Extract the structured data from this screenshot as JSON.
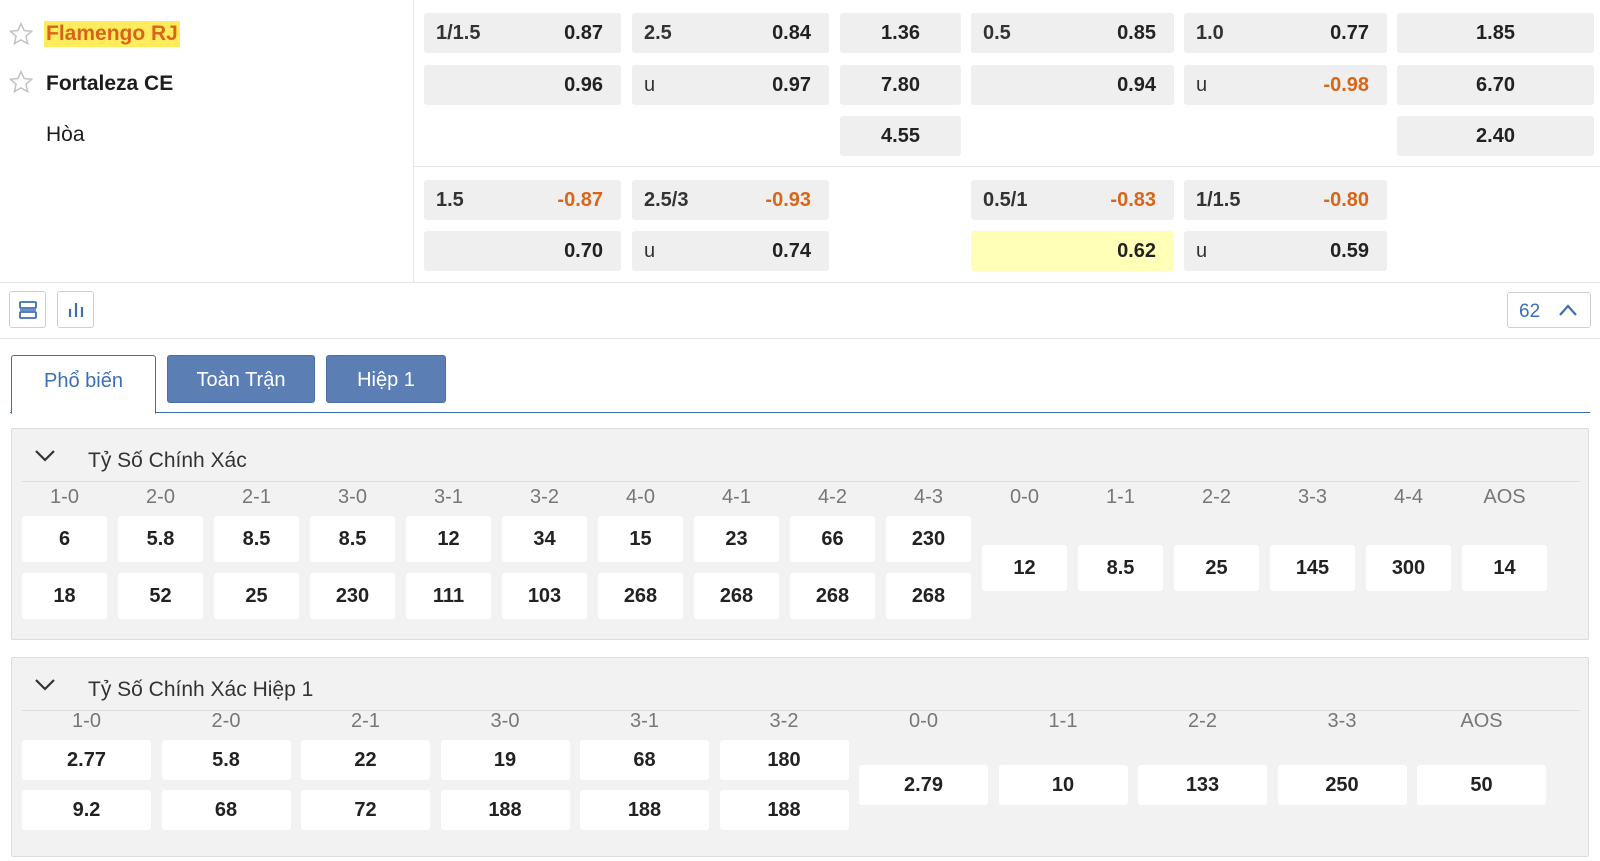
{
  "match": {
    "home": "Flamengo RJ",
    "away": "Fortaleza CE",
    "draw": "Hòa"
  },
  "odds": {
    "r1": {
      "hdp_line": "1/1.5",
      "hdp_home": "0.87",
      "ou_line": "2.5",
      "ou_over": "0.84",
      "x12_home": "1.36",
      "h1_hdp_line": "0.5",
      "h1_hdp_home": "0.85",
      "h1_ou_line": "1.0",
      "h1_ou_over": "0.77",
      "h1_x12_home": "1.85"
    },
    "r2": {
      "hdp_away": "0.96",
      "ou_u": "u",
      "ou_under": "0.97",
      "x12_away": "7.80",
      "h1_hdp_away": "0.94",
      "h1_ou_u": "u",
      "h1_ou_under": "-0.98",
      "h1_x12_away": "6.70"
    },
    "r3": {
      "x12_draw": "4.55",
      "h1_x12_draw": "2.40"
    },
    "r4": {
      "hdp_line": "1.5",
      "hdp_home": "-0.87",
      "ou_line": "2.5/3",
      "ou_over": "-0.93",
      "h1_hdp_line": "0.5/1",
      "h1_hdp_home": "-0.83",
      "h1_ou_line": "1/1.5",
      "h1_ou_over": "-0.80"
    },
    "r5": {
      "hdp_away": "0.70",
      "ou_u": "u",
      "ou_under": "0.74",
      "h1_hdp_away": "0.62",
      "h1_ou_u": "u",
      "h1_ou_under": "0.59"
    }
  },
  "toolbar": {
    "count": "62"
  },
  "tabs": [
    "Phổ biến",
    "Toàn Trận",
    "Hiệp 1"
  ],
  "correct_score": {
    "title": "Tỷ Số Chính Xác",
    "headers": [
      "1-0",
      "2-0",
      "2-1",
      "3-0",
      "3-1",
      "3-2",
      "4-0",
      "4-1",
      "4-2",
      "4-3",
      "0-0",
      "1-1",
      "2-2",
      "3-3",
      "4-4",
      "AOS"
    ],
    "home_row": [
      "6",
      "5.8",
      "8.5",
      "8.5",
      "12",
      "34",
      "15",
      "23",
      "66",
      "230"
    ],
    "away_row": [
      "18",
      "52",
      "25",
      "230",
      "111",
      "103",
      "268",
      "268",
      "268",
      "268"
    ],
    "draw_row": [
      "12",
      "8.5",
      "25",
      "145",
      "300",
      "14"
    ]
  },
  "correct_score_h1": {
    "title": "Tỷ Số Chính Xác Hiệp 1",
    "headers": [
      "1-0",
      "2-0",
      "2-1",
      "3-0",
      "3-1",
      "3-2",
      "0-0",
      "1-1",
      "2-2",
      "3-3",
      "AOS"
    ],
    "home_row": [
      "2.77",
      "5.8",
      "22",
      "19",
      "68",
      "180"
    ],
    "away_row": [
      "9.2",
      "68",
      "72",
      "188",
      "188",
      "188"
    ],
    "draw_row": [
      "2.79",
      "10",
      "133",
      "250",
      "50"
    ]
  },
  "colors": {
    "accent": "#3c6eb4",
    "negative": "#d9651a",
    "highlight": "#ffec5c",
    "tab_blue": "#5b7fb5"
  }
}
